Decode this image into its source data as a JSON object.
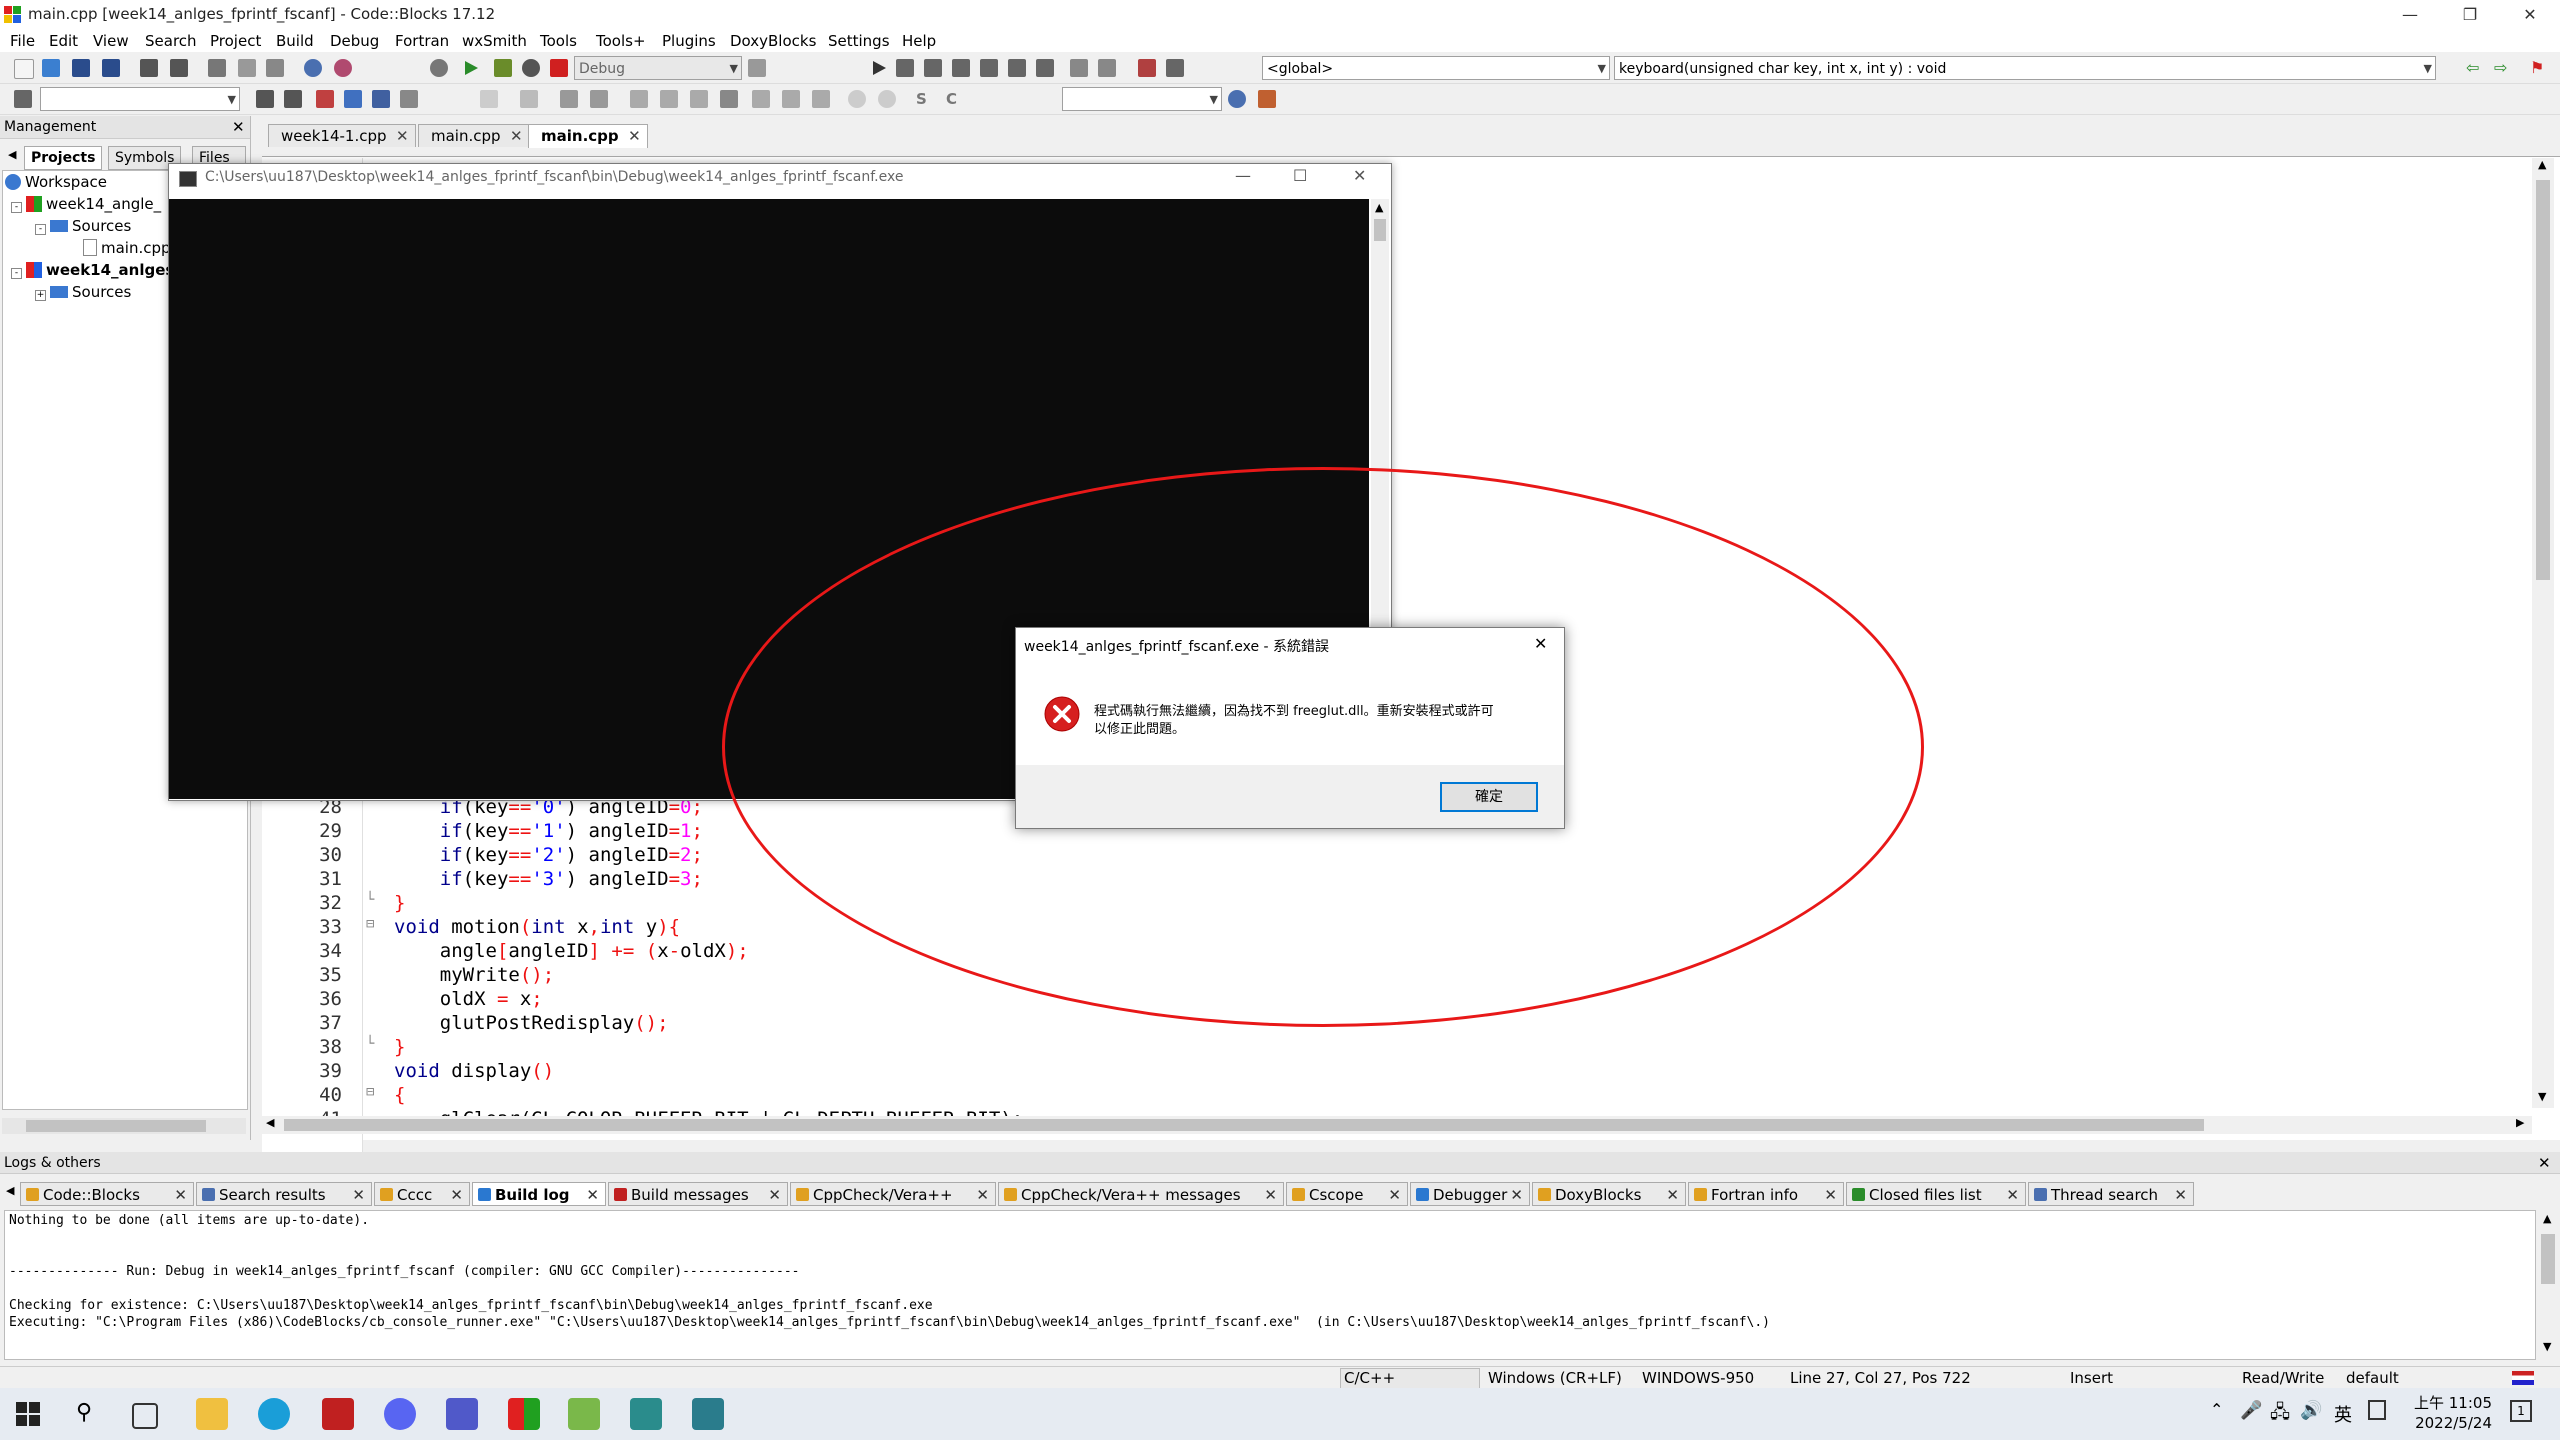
{
  "window": {
    "title": "main.cpp [week14_anlges_fprintf_fscanf] - Code::Blocks 17.12"
  },
  "menu": [
    "File",
    "Edit",
    "View",
    "Search",
    "Project",
    "Build",
    "Debug",
    "Fortran",
    "wxSmith",
    "Tools",
    "Tools+",
    "Plugins",
    "DoxyBlocks",
    "Settings",
    "Help"
  ],
  "toolbar": {
    "build_target": "Debug",
    "scope": "<global>",
    "function": "keyboard(unsigned char key, int x, int y) : void"
  },
  "management": {
    "title": "Management",
    "tabs": [
      "Projects",
      "Symbols",
      "Files"
    ],
    "tree": [
      {
        "label": "Workspace",
        "level": 0
      },
      {
        "label": "week14_angle_",
        "level": 1
      },
      {
        "label": "Sources",
        "level": 2
      },
      {
        "label": "main.cpp",
        "level": 3
      },
      {
        "label": "week14_anlges",
        "level": 1
      },
      {
        "label": "Sources",
        "level": 2
      }
    ]
  },
  "editor": {
    "tabs": [
      "week14-1.cpp",
      "main.cpp",
      "main.cpp"
    ],
    "active_tab": 2,
    "lines": [
      {
        "n": "28",
        "code": [
          [
            "    "
          ],
          [
            "if",
            "kw"
          ],
          [
            "(key"
          ],
          [
            "==",
            "op"
          ],
          [
            "'0'",
            "str"
          ],
          [
            ") angleID"
          ],
          [
            "=",
            "op"
          ],
          [
            "0",
            "num"
          ],
          [
            ";",
            "op"
          ]
        ]
      },
      {
        "n": "29",
        "code": [
          [
            "    "
          ],
          [
            "if",
            "kw"
          ],
          [
            "(key"
          ],
          [
            "==",
            "op"
          ],
          [
            "'1'",
            "str"
          ],
          [
            ") angleID"
          ],
          [
            "=",
            "op"
          ],
          [
            "1",
            "num"
          ],
          [
            ";",
            "op"
          ]
        ]
      },
      {
        "n": "30",
        "code": [
          [
            "    "
          ],
          [
            "if",
            "kw"
          ],
          [
            "(key"
          ],
          [
            "==",
            "op"
          ],
          [
            "'2'",
            "str"
          ],
          [
            ") angleID"
          ],
          [
            "=",
            "op"
          ],
          [
            "2",
            "num"
          ],
          [
            ";",
            "op"
          ]
        ]
      },
      {
        "n": "31",
        "code": [
          [
            "    "
          ],
          [
            "if",
            "kw"
          ],
          [
            "(key"
          ],
          [
            "==",
            "op"
          ],
          [
            "'3'",
            "str"
          ],
          [
            ") angleID"
          ],
          [
            "=",
            "op"
          ],
          [
            "3",
            "num"
          ],
          [
            ";",
            "op"
          ]
        ]
      },
      {
        "n": "32",
        "code": [
          [
            "}",
            "op"
          ]
        ]
      },
      {
        "n": "33",
        "code": [
          [
            "void",
            "kw"
          ],
          [
            " motion"
          ],
          [
            "(",
            "op"
          ],
          [
            "int",
            "kw"
          ],
          [
            " x"
          ],
          [
            ",",
            "op"
          ],
          [
            "int",
            "kw"
          ],
          [
            " y"
          ],
          [
            ")",
            "op"
          ],
          [
            "{",
            "op"
          ]
        ]
      },
      {
        "n": "34",
        "code": [
          [
            "    angle"
          ],
          [
            "[",
            "op"
          ],
          [
            "angleID"
          ],
          [
            "]",
            "op"
          ],
          [
            " "
          ],
          [
            "+=",
            "op"
          ],
          [
            " "
          ],
          [
            "(",
            "op"
          ],
          [
            "x"
          ],
          [
            "-",
            "op"
          ],
          [
            "oldX"
          ],
          [
            ");",
            "op"
          ]
        ]
      },
      {
        "n": "35",
        "code": [
          [
            "    myWrite"
          ],
          [
            "();",
            "op"
          ]
        ]
      },
      {
        "n": "36",
        "code": [
          [
            "    oldX "
          ],
          [
            "=",
            "op"
          ],
          [
            " x"
          ],
          [
            ";",
            "op"
          ]
        ]
      },
      {
        "n": "37",
        "code": [
          [
            "    glutPostRedisplay"
          ],
          [
            "();",
            "op"
          ]
        ]
      },
      {
        "n": "38",
        "code": [
          [
            "}",
            "op"
          ]
        ]
      },
      {
        "n": "39",
        "code": [
          [
            "void",
            "kw"
          ],
          [
            " display"
          ],
          [
            "()",
            "op"
          ]
        ]
      },
      {
        "n": "40",
        "code": [
          [
            "{",
            "op"
          ]
        ]
      },
      {
        "n": "41",
        "code": [
          [
            "    glClear(GL_COLOR_BUFFER_BIT | GL_DEPTH_BUFFER_BIT);"
          ]
        ]
      }
    ]
  },
  "console_window": {
    "title": "C:\\Users\\uu187\\Desktop\\week14_anlges_fprintf_fscanf\\bin\\Debug\\week14_anlges_fprintf_fscanf.exe"
  },
  "error_dialog": {
    "title": "week14_anlges_fprintf_fscanf.exe - 系統錯誤",
    "message_line1": "程式碼執行無法繼續，因為找不到 freeglut.dll。重新安裝程式或許可",
    "message_line2": "以修正此問題。",
    "ok_label": "確定"
  },
  "logs": {
    "title": "Logs & others",
    "tabs": [
      "Code::Blocks",
      "Search results",
      "Cccc",
      "Build log",
      "Build messages",
      "CppCheck/Vera++",
      "CppCheck/Vera++ messages",
      "Cscope",
      "Debugger",
      "DoxyBlocks",
      "Fortran info",
      "Closed files list",
      "Thread search"
    ],
    "active_tab": 3,
    "lines": [
      "Nothing to be done (all items are up-to-date).",
      "",
      "",
      "-------------- Run: Debug in week14_anlges_fprintf_fscanf (compiler: GNU GCC Compiler)---------------",
      "",
      "Checking for existence: C:\\Users\\uu187\\Desktop\\week14_anlges_fprintf_fscanf\\bin\\Debug\\week14_anlges_fprintf_fscanf.exe",
      "Executing: \"C:\\Program Files (x86)\\CodeBlocks/cb_console_runner.exe\" \"C:\\Users\\uu187\\Desktop\\week14_anlges_fprintf_fscanf\\bin\\Debug\\week14_anlges_fprintf_fscanf.exe\"  (in C:\\Users\\uu187\\Desktop\\week14_anlges_fprintf_fscanf\\.)"
    ]
  },
  "statusbar": {
    "language": "C/C++",
    "eol": "Windows (CR+LF)",
    "encoding": "WINDOWS-950",
    "position": "Line 27, Col 27, Pos 722",
    "mode": "Insert",
    "access": "Read/Write",
    "profile": "default"
  },
  "taskbar": {
    "ime": "英",
    "time": "上午 11:05",
    "date": "2022/5/24",
    "notifications": "1"
  },
  "colors": {
    "annotation_ellipse": "#e81818",
    "error_icon": "#d61f1f",
    "accent": "#0078d4"
  }
}
